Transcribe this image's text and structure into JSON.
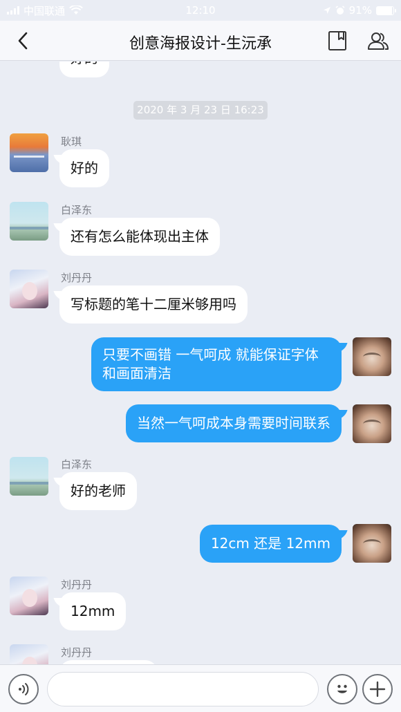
{
  "status_bar": {
    "carrier": "中国联通",
    "time": "12:10",
    "battery": "91%",
    "battery_level": 0.91
  },
  "header": {
    "title": "创意海报设计-生沅承"
  },
  "chat": {
    "partial_top_message": "好的",
    "timestamp": "2020 年 3 月 23 日 16:23",
    "messages": [
      {
        "sender": "耿琪",
        "text": "好的",
        "direction": "in",
        "avatar": "sunset-pier-avatar"
      },
      {
        "sender": "白泽东",
        "text": "还有怎么能体现出主体",
        "direction": "in",
        "avatar": "beach-avatar"
      },
      {
        "sender": "刘丹丹",
        "text": "写标题的笔十二厘米够用吗",
        "direction": "in",
        "avatar": "anime-girl-avatar"
      },
      {
        "sender": "",
        "text": "只要不画错 一气呵成 就能保证字体和画面清洁",
        "direction": "out",
        "avatar": "cat-avatar"
      },
      {
        "sender": "",
        "text": "当然一气呵成本身需要时间联系",
        "direction": "out",
        "avatar": "cat-avatar"
      },
      {
        "sender": "白泽东",
        "text": "好的老师",
        "direction": "in",
        "avatar": "beach-avatar"
      },
      {
        "sender": "",
        "text": "12cm 还是 12mm",
        "direction": "out",
        "avatar": "cat-avatar"
      },
      {
        "sender": "刘丹丹",
        "text": "12mm",
        "direction": "in",
        "avatar": "anime-girl-avatar"
      },
      {
        "sender": "刘丹丹",
        "text": "",
        "direction": "in",
        "avatar": "anime-girl-avatar"
      }
    ]
  },
  "input_bar": {
    "value": ""
  },
  "colors": {
    "outgoing_bubble": "#2aa2f7",
    "incoming_bubble": "#ffffff",
    "background": "#eaedf4"
  }
}
